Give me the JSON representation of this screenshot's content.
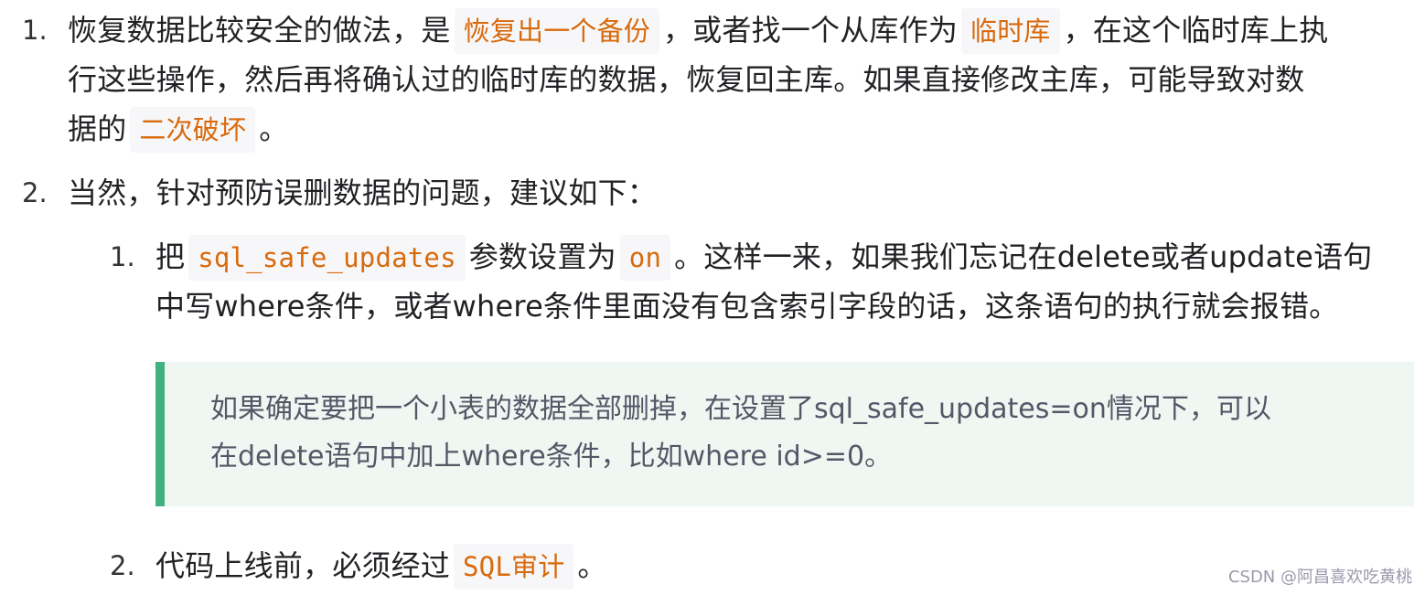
{
  "items": {
    "n1": "1.",
    "l1_a": "恢复数据比较安全的做法，是",
    "l1_code1": "恢复出一个备份",
    "l1_b": "，或者找一个从库作为",
    "l1_code2": "临时库",
    "l1_c": "，在这个临时库上执",
    "l2": "行这些操作，然后再将确认过的临时库的数据，恢复回主库。如果直接修改主库，可能导致对数",
    "l3_a": "据的",
    "l3_code": "二次破坏",
    "l3_b": "。",
    "n2": "2.",
    "l4": "当然，针对预防误删数据的问题，建议如下：",
    "sub1_num": "1.",
    "sub1_a": "把",
    "sub1_code1": "sql_safe_updates",
    "sub1_b": "参数设置为",
    "sub1_code2": "on",
    "sub1_c": "。这样一来，如果我们忘记在delete或者update语句",
    "sub1_l2": "中写where条件，或者where条件里面没有包含索引字段的话，这条语句的执行就会报错。",
    "quote_l1": "如果确定要把一个小表的数据全部删掉，在设置了sql_safe_updates=on情况下，可以",
    "quote_l2": "在delete语句中加上where条件，比如where id>=0。",
    "sub2_num": "2.",
    "sub2_a": "代码上线前，必须经过",
    "sub2_code": "SQL审计",
    "sub2_b": "。"
  },
  "watermark": "CSDN @阿昌喜欢吃黄桃",
  "colors": {
    "code_text": "#d86a0c",
    "code_bg": "#f7f7f9",
    "quote_bar": "#3fb27f",
    "quote_bg": "#eef7f2"
  }
}
